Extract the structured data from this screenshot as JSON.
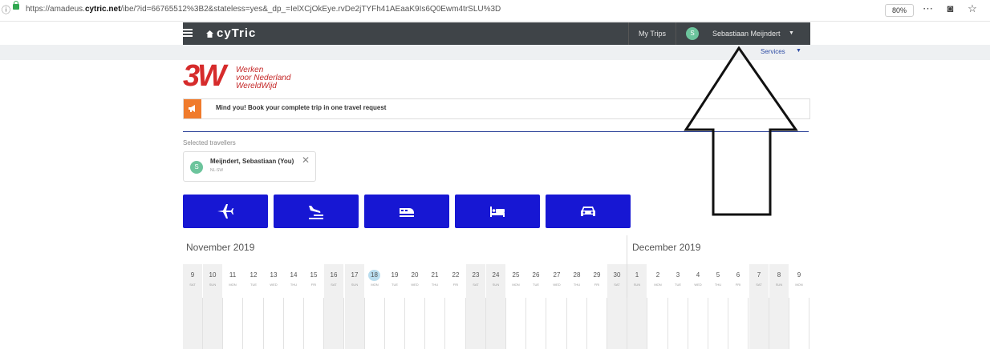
{
  "browser": {
    "info_glyph": "ⓘ",
    "url_prefix": "https://amadeus.",
    "url_domain": "cytric.net",
    "url_rest": "/ibe/?id=66765512%3B2&stateless=yes&_dp_=IelXCjOkEye.rvDe2jTYFh41AEaaK9Is6Q0Ewm4trSLU%3D",
    "zoom": "80%",
    "toolbar_glyphs": "⋯ ◙ ☆ ≡"
  },
  "header": {
    "logo": "cyTric",
    "my_trips": "My Trips",
    "user_initial": "S",
    "user_name": "Sebastiaan Meijndert",
    "user_caret": "▼",
    "services": "Services",
    "services_caret": "▼"
  },
  "brand": {
    "mark": "3W",
    "line1": "Werken",
    "line2": "voor Nederland",
    "line3": "WereldWijd"
  },
  "notice": {
    "text": "Mind you! Book your complete trip in one travel request",
    "icon": "megaphone-icon"
  },
  "travellers": {
    "label": "Selected travellers",
    "items": [
      {
        "initial": "S",
        "name": "Meijndert, Sebastiaan (You)",
        "code": "NL-SW",
        "remove": "✕"
      }
    ]
  },
  "products": [
    {
      "name": "flight",
      "icon": "airplane-icon"
    },
    {
      "name": "flight-hotel",
      "icon": "airplane-landing-icon"
    },
    {
      "name": "train",
      "icon": "train-icon"
    },
    {
      "name": "hotel",
      "icon": "bed-icon"
    },
    {
      "name": "car",
      "icon": "car-icon"
    }
  ],
  "calendar": {
    "months": [
      "November 2019",
      "December 2019"
    ],
    "days": [
      {
        "n": "9",
        "w": "SAT"
      },
      {
        "n": "10",
        "w": "SUN"
      },
      {
        "n": "11",
        "w": "MON"
      },
      {
        "n": "12",
        "w": "TUE"
      },
      {
        "n": "13",
        "w": "WED"
      },
      {
        "n": "14",
        "w": "THU"
      },
      {
        "n": "15",
        "w": "FRI"
      },
      {
        "n": "16",
        "w": "SAT"
      },
      {
        "n": "17",
        "w": "SUN"
      },
      {
        "n": "18",
        "w": "MON"
      },
      {
        "n": "19",
        "w": "TUE"
      },
      {
        "n": "20",
        "w": "WED"
      },
      {
        "n": "21",
        "w": "THU"
      },
      {
        "n": "22",
        "w": "FRI"
      },
      {
        "n": "23",
        "w": "SAT"
      },
      {
        "n": "24",
        "w": "SUN"
      },
      {
        "n": "25",
        "w": "MON"
      },
      {
        "n": "26",
        "w": "TUE"
      },
      {
        "n": "27",
        "w": "WED"
      },
      {
        "n": "28",
        "w": "THU"
      },
      {
        "n": "29",
        "w": "FRI"
      },
      {
        "n": "30",
        "w": "SAT"
      },
      {
        "n": "1",
        "w": "SUN"
      },
      {
        "n": "2",
        "w": "MON"
      },
      {
        "n": "3",
        "w": "TUE"
      },
      {
        "n": "4",
        "w": "WED"
      },
      {
        "n": "5",
        "w": "THU"
      },
      {
        "n": "6",
        "w": "FRI"
      },
      {
        "n": "7",
        "w": "SAT"
      },
      {
        "n": "8",
        "w": "SUN"
      },
      {
        "n": "9",
        "w": "MON"
      }
    ],
    "today_index": 9
  },
  "colors": {
    "accent": "#1717d3",
    "header_bg": "#3f4448",
    "notice_orange": "#f07b2c",
    "brand_red": "#d62b2b"
  }
}
